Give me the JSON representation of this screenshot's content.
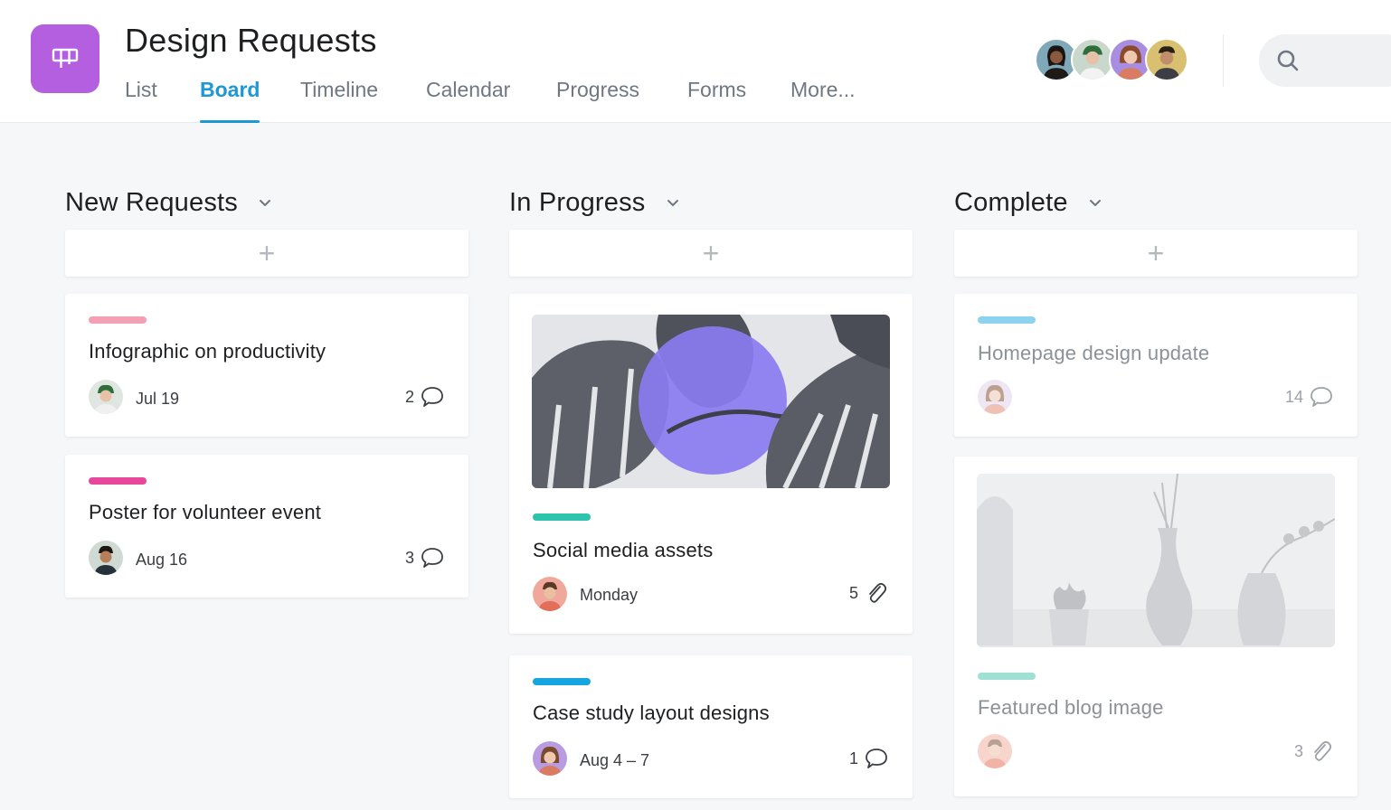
{
  "header": {
    "title": "Design Requests",
    "tabs": [
      {
        "label": "List"
      },
      {
        "label": "Board"
      },
      {
        "label": "Timeline"
      },
      {
        "label": "Calendar"
      },
      {
        "label": "Progress"
      },
      {
        "label": "Forms"
      },
      {
        "label": "More..."
      }
    ],
    "active_tab": "Board",
    "app_icon": "board-icon",
    "app_color": "#b35fe0",
    "accent_color": "#1e97d6",
    "search_icon": "search-icon",
    "members_count_shown": 4
  },
  "columns": [
    {
      "title": "New Requests",
      "add_label": "+",
      "cards": [
        {
          "title": "Infographic on productivity",
          "tag_color": "#f3a0b5",
          "due": "Jul 19",
          "count": "2",
          "count_icon": "comment-icon"
        },
        {
          "title": "Poster for volunteer event",
          "tag_color": "#e8489b",
          "due": "Aug 16",
          "count": "3",
          "count_icon": "comment-icon"
        }
      ]
    },
    {
      "title": "In Progress",
      "add_label": "+",
      "cards": [
        {
          "title": "Social media assets",
          "tag_color": "#2dc4ad",
          "due": "Monday",
          "count": "5",
          "count_icon": "attachment-icon",
          "has_image": true
        },
        {
          "title": "Case study layout designs",
          "tag_color": "#16a5e0",
          "due": "Aug 4 – 7",
          "count": "1",
          "count_icon": "comment-icon"
        }
      ]
    },
    {
      "title": "Complete",
      "add_label": "+",
      "cards": [
        {
          "title": "Homepage design update",
          "tag_color": "#8dd3f0",
          "due": "",
          "count": "14",
          "count_icon": "comment-icon",
          "completed": true
        },
        {
          "title": "Featured blog image",
          "tag_color": "#9ee0d4",
          "due": "",
          "count": "3",
          "count_icon": "attachment-icon",
          "completed": true,
          "has_image": true
        }
      ]
    }
  ]
}
